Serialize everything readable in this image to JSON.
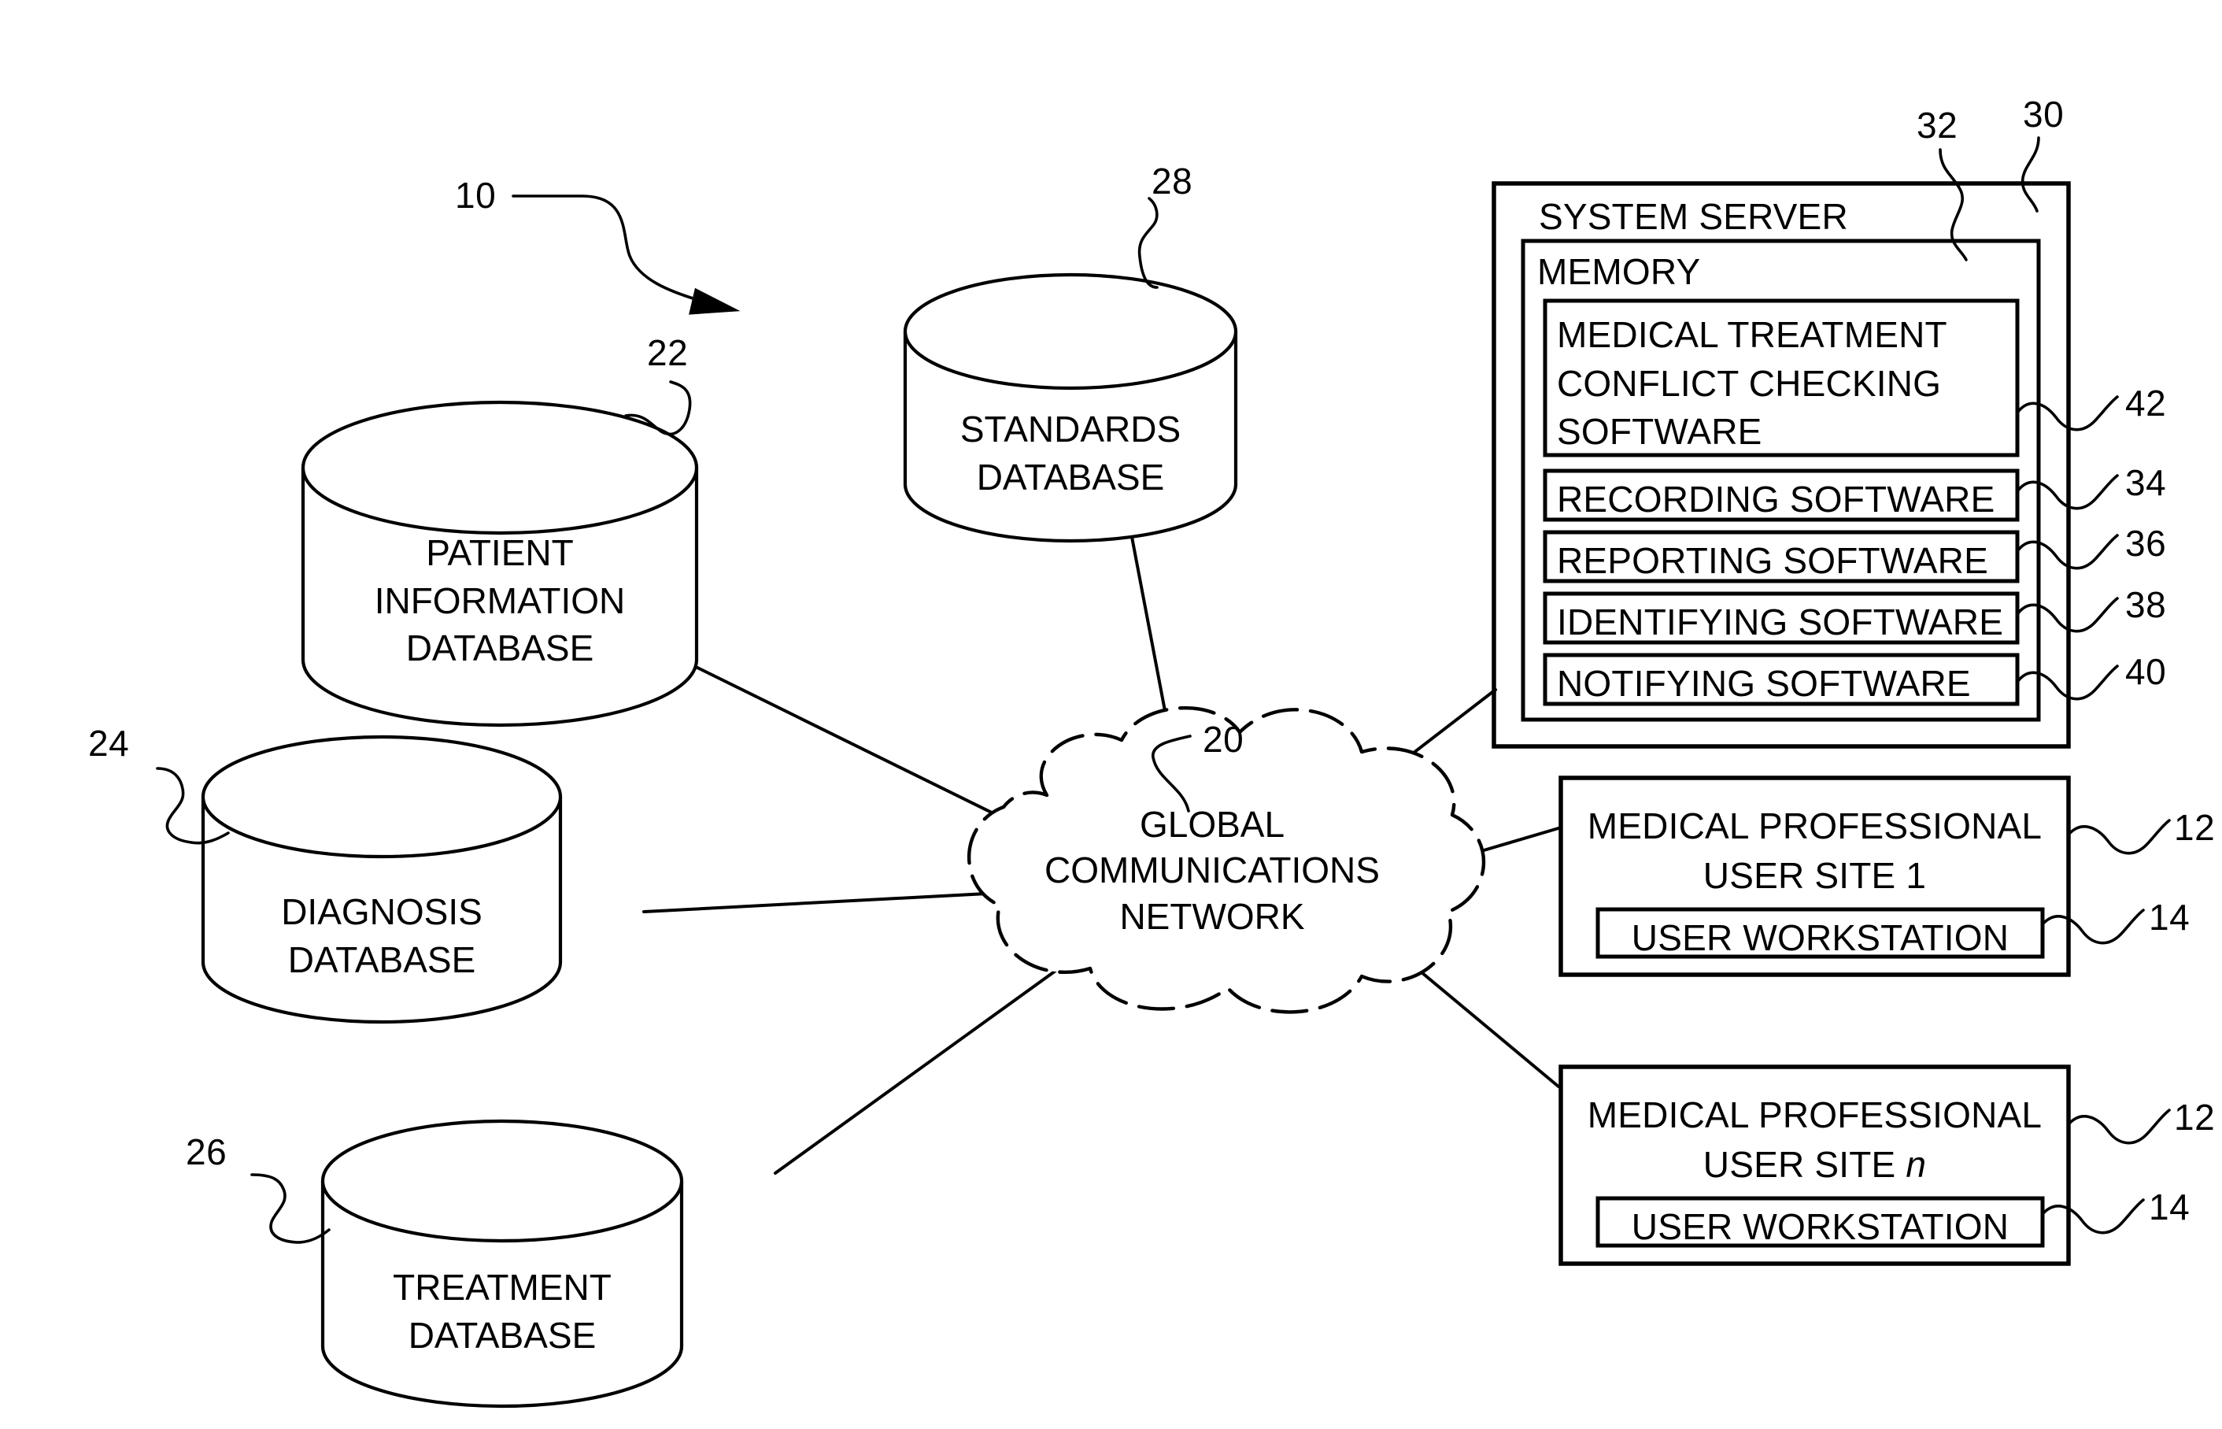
{
  "figure": {
    "title_ref": "10",
    "type": "patent-system-diagram"
  },
  "reference_numerals": {
    "system": "10",
    "user_site": "12",
    "user_workstation": "14",
    "network": "20",
    "patient_information_database": "22",
    "diagnosis_database": "24",
    "treatment_database": "26",
    "standards_database": "28",
    "system_server": "30",
    "memory": "32",
    "recording_software": "34",
    "reporting_software": "36",
    "identifying_software": "38",
    "notifying_software": "40",
    "conflict_checking_software": "42"
  },
  "databases": [
    {
      "id": "patient-information-database",
      "ref": "22",
      "lines": [
        "PATIENT",
        "INFORMATION",
        "DATABASE"
      ]
    },
    {
      "id": "standards-database",
      "ref": "28",
      "lines": [
        "STANDARDS",
        "DATABASE"
      ]
    },
    {
      "id": "diagnosis-database",
      "ref": "24",
      "lines": [
        "DIAGNOSIS",
        "DATABASE"
      ]
    },
    {
      "id": "treatment-database",
      "ref": "26",
      "lines": [
        "TREATMENT",
        "DATABASE"
      ]
    }
  ],
  "network": {
    "ref": "20",
    "lines": [
      "GLOBAL",
      "COMMUNICATIONS",
      "NETWORK"
    ]
  },
  "system_server": {
    "ref": "30",
    "title": "SYSTEM SERVER",
    "memory": {
      "ref": "32",
      "title": "MEMORY",
      "modules": [
        {
          "id": "conflict-checking-software",
          "ref": "42",
          "lines": [
            "MEDICAL TREATMENT",
            "CONFLICT CHECKING",
            "SOFTWARE"
          ]
        },
        {
          "id": "recording-software",
          "ref": "34",
          "lines": [
            "RECORDING SOFTWARE"
          ]
        },
        {
          "id": "reporting-software",
          "ref": "36",
          "lines": [
            "REPORTING SOFTWARE"
          ]
        },
        {
          "id": "identifying-software",
          "ref": "38",
          "lines": [
            "IDENTIFYING SOFTWARE"
          ]
        },
        {
          "id": "notifying-software",
          "ref": "40",
          "lines": [
            "NOTIFYING SOFTWARE"
          ]
        }
      ]
    }
  },
  "user_sites": [
    {
      "id": "user-site-1",
      "ref": "12",
      "line1": "MEDICAL PROFESSIONAL",
      "line2_prefix": "USER SITE ",
      "line2_suffix": "1",
      "line2_italic": false,
      "workstation": {
        "ref": "14",
        "label": "USER WORKSTATION"
      }
    },
    {
      "id": "user-site-n",
      "ref": "12",
      "line1": "MEDICAL PROFESSIONAL",
      "line2_prefix": "USER SITE ",
      "line2_suffix": "n",
      "line2_italic": true,
      "workstation": {
        "ref": "14",
        "label": "USER WORKSTATION"
      }
    }
  ],
  "colors": {
    "ink": "#000000",
    "paper": "#ffffff"
  }
}
